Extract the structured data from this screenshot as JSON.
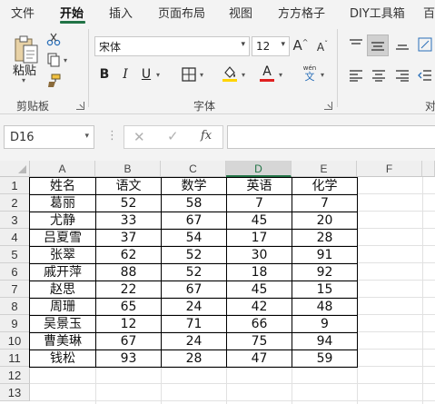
{
  "tabs": [
    {
      "label": "文件"
    },
    {
      "label": "开始"
    },
    {
      "label": "插入"
    },
    {
      "label": "页面布局"
    },
    {
      "label": "视图"
    },
    {
      "label": "方方格子"
    },
    {
      "label": "DIY工具箱"
    },
    {
      "label": "百"
    }
  ],
  "ribbon": {
    "clipboard": {
      "paste_label": "粘贴",
      "group_label": "剪贴板"
    },
    "font": {
      "font_name": "宋体",
      "font_size": "12",
      "bold": "B",
      "italic": "I",
      "underline": "U",
      "grow": "A",
      "shrink": "A",
      "phonetic": "wén",
      "font_color_letter": "A",
      "group_label": "字体"
    },
    "alignment": {
      "group_label": "对"
    }
  },
  "formula_bar": {
    "name_box": "D16",
    "fx_label": "fx",
    "formula": ""
  },
  "sheet": {
    "columns": [
      "A",
      "B",
      "C",
      "D",
      "E",
      "F"
    ],
    "selected_column": "D",
    "rows": [
      "1",
      "2",
      "3",
      "4",
      "5",
      "6",
      "7",
      "8",
      "9",
      "10",
      "11",
      "12",
      "13"
    ],
    "header": [
      "姓名",
      "语文",
      "数学",
      "英语",
      "化学"
    ],
    "records": [
      [
        "葛丽",
        "52",
        "58",
        "7",
        "7"
      ],
      [
        "尤静",
        "33",
        "67",
        "45",
        "20"
      ],
      [
        "吕夏雪",
        "37",
        "54",
        "17",
        "28"
      ],
      [
        "张翠",
        "62",
        "52",
        "30",
        "91"
      ],
      [
        "戚开萍",
        "88",
        "52",
        "18",
        "92"
      ],
      [
        "赵思",
        "22",
        "67",
        "45",
        "15"
      ],
      [
        "周珊",
        "65",
        "24",
        "42",
        "48"
      ],
      [
        "吴景玉",
        "12",
        "71",
        "66",
        "9"
      ],
      [
        "曹美琳",
        "67",
        "24",
        "75",
        "94"
      ],
      [
        "钱松",
        "93",
        "28",
        "47",
        "59"
      ]
    ]
  },
  "colors": {
    "accent": "#217346",
    "highlight": "#ffd400",
    "font_color": "#e02020",
    "selected_header": "#d6d6d6"
  }
}
